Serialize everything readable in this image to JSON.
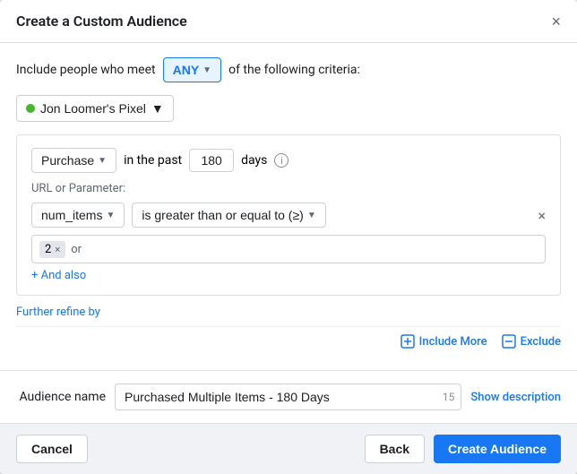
{
  "modal": {
    "title": "Create a Custom Audience",
    "close_label": "×"
  },
  "criteria": {
    "include_label": "Include people who meet",
    "any_label": "ANY",
    "following_label": "of the following criteria:"
  },
  "pixel": {
    "name": "Jon Loomer's Pixel"
  },
  "event": {
    "type": "Purchase",
    "in_the_past_label": "in the past",
    "days_value": "180",
    "days_label": "days"
  },
  "url_param": {
    "label": "URL or Parameter:",
    "param_name": "num_items",
    "condition": "is greater than or equal to (≥)"
  },
  "value_tag": {
    "value": "2",
    "or_label": "or"
  },
  "and_also": {
    "label": "+ And also"
  },
  "further_refine": {
    "label": "Further refine by"
  },
  "include_more": {
    "label": "Include More"
  },
  "exclude": {
    "label": "Exclude"
  },
  "audience_name": {
    "label": "Audience name",
    "value": "Purchased Multiple Items - 180 Days",
    "char_count": "15",
    "show_description_label": "Show description"
  },
  "footer": {
    "cancel_label": "Cancel",
    "back_label": "Back",
    "create_label": "Create Audience"
  }
}
